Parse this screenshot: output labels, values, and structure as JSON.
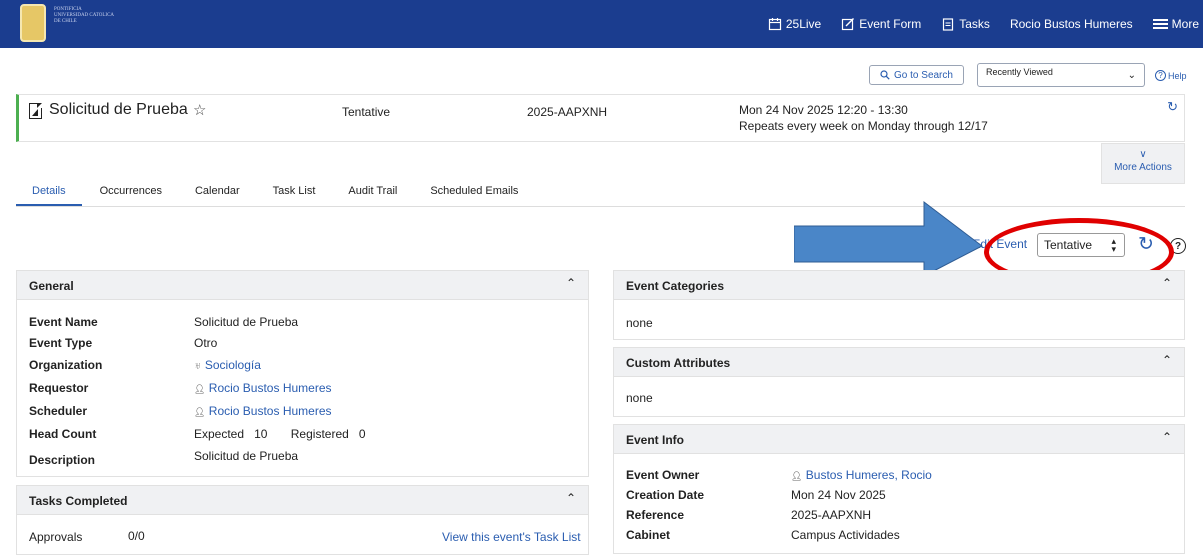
{
  "topbar": {
    "logo_text": "Pontificia Universidad Catolica de Chile",
    "nav": {
      "live": "25Live",
      "event_form": "Event Form",
      "tasks": "Tasks",
      "user": "Rocio Bustos Humeres",
      "more": "More"
    },
    "bg_color": "#1b3d8f"
  },
  "toolbar": {
    "search_button": "Go to Search",
    "recently_viewed": "Recently Viewed",
    "help": "Help"
  },
  "event": {
    "title": "Solicitud de Prueba",
    "state": "Tentative",
    "reference": "2025-AAPXNH",
    "date": "Mon 24 Nov 2025 12:20 - 13:30",
    "repeat": "Repeats every week on Monday through 12/17"
  },
  "more_actions": "More Actions",
  "tabs": [
    "Details",
    "Occurrences",
    "Calendar",
    "Task List",
    "Audit Trail",
    "Scheduled Emails"
  ],
  "actions": {
    "edit_event": "Edit Event",
    "state_value": "Tentative"
  },
  "general": {
    "title": "General",
    "rows": [
      {
        "label": "Event Name",
        "value": "Solicitud de Prueba"
      },
      {
        "label": "Event Type",
        "value": "Otro"
      },
      {
        "label": "Organization",
        "value": "Sociología"
      },
      {
        "label": "Requestor",
        "value": "Rocio Bustos Humeres"
      },
      {
        "label": "Scheduler",
        "value": "Rocio Bustos Humeres"
      },
      {
        "label": "Head Count",
        "expected_label": "Expected",
        "expected": "10",
        "registered_label": "Registered",
        "registered": "0"
      },
      {
        "label": "Description",
        "value": "Solicitud de Prueba"
      }
    ]
  },
  "tasks_completed": {
    "title": "Tasks Completed",
    "approvals_label": "Approvals",
    "approvals_value": "0/0",
    "task_list_link": "View this event's Task List"
  },
  "event_categories": {
    "title": "Event Categories",
    "value": "none"
  },
  "custom_attributes": {
    "title": "Custom Attributes",
    "value": "none"
  },
  "event_info": {
    "title": "Event Info",
    "rows": [
      {
        "label": "Event Owner",
        "value": "Bustos Humeres, Rocio"
      },
      {
        "label": "Creation Date",
        "value": "Mon 24 Nov 2025"
      },
      {
        "label": "Reference",
        "value": "2025-AAPXNH"
      },
      {
        "label": "Cabinet",
        "value": "Campus Actividades"
      }
    ]
  },
  "colors": {
    "accent": "#2a5db0",
    "annotation_arrow": "#4a86c8",
    "annotation_circle": "#e00000"
  }
}
